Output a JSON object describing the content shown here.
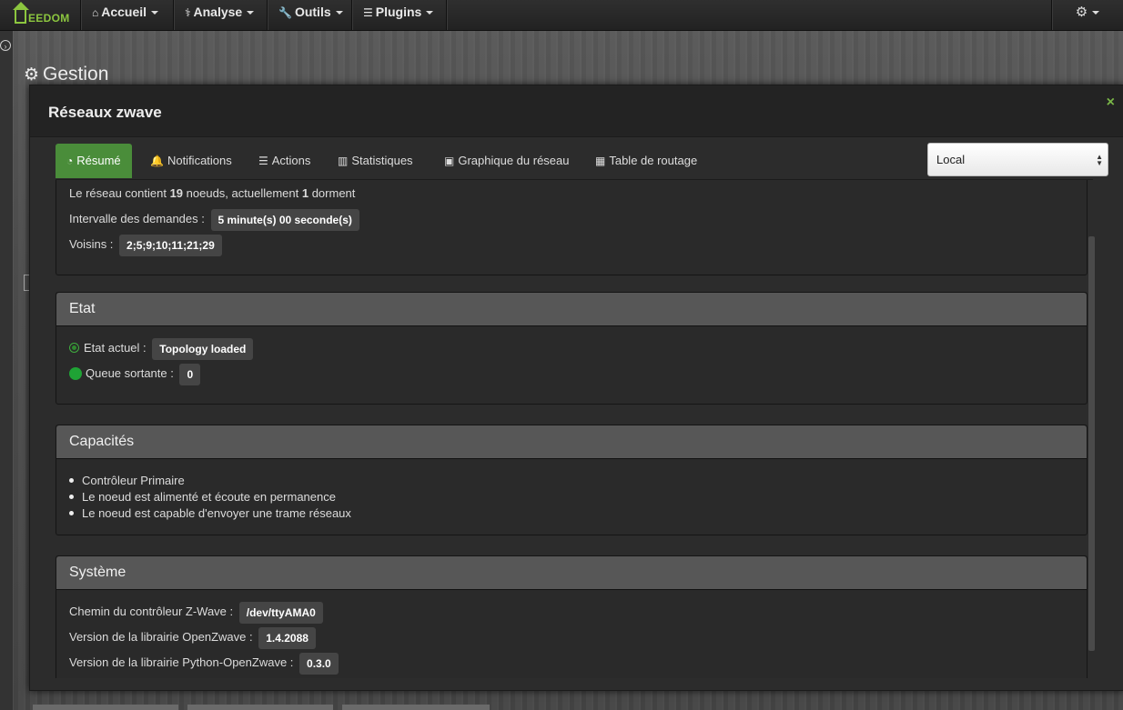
{
  "navbar": {
    "brand": "EEDOM",
    "items": [
      {
        "icon": "home-icon",
        "glyph": "⌂",
        "label": "Accueil"
      },
      {
        "icon": "stethoscope-icon",
        "glyph": "⚕",
        "label": "Analyse"
      },
      {
        "icon": "wrench-icon",
        "glyph": "🔧",
        "label": "Outils"
      },
      {
        "icon": "list-icon",
        "glyph": "☰",
        "label": "Plugins"
      }
    ],
    "settings_glyph": "⚙"
  },
  "page": {
    "title": "Gestion"
  },
  "modal": {
    "title": "Réseaux zwave",
    "close_glyph": "×",
    "tabs": [
      {
        "icon": "dashboard-icon",
        "glyph": "◔",
        "label": "Résumé",
        "active": true
      },
      {
        "icon": "bell-icon",
        "glyph": "🔔",
        "label": "Notifications"
      },
      {
        "icon": "sliders-icon",
        "glyph": "☰",
        "label": "Actions"
      },
      {
        "icon": "bar-chart-icon",
        "glyph": "▥",
        "label": "Statistiques"
      },
      {
        "icon": "image-icon",
        "glyph": "▣",
        "label": "Graphique du réseau"
      },
      {
        "icon": "table-icon",
        "glyph": "▦",
        "label": "Table de routage"
      }
    ],
    "controller_select": {
      "selected": "Local"
    }
  },
  "summary_panel": {
    "network_text_prefix": "Le réseau contient ",
    "nodes_count": "19",
    "network_text_mid": " noeuds, actuellement ",
    "sleeping_count": "1",
    "network_text_suffix": " dorment",
    "interval_label": "Intervalle des demandes :",
    "interval_value": "5 minute(s) 00 seconde(s)",
    "neighbors_label": "Voisins :",
    "neighbors_value": "2;5;9;10;11;21;29"
  },
  "etat_panel": {
    "title": "Etat",
    "current_label": "Etat actuel :",
    "current_value": "Topology loaded",
    "queue_label": "Queue sortante :",
    "queue_value": "0",
    "status_color": "#1fa335"
  },
  "capacites_panel": {
    "title": "Capacités",
    "items": [
      "Contrôleur Primaire",
      "Le noeud est alimenté et écoute en permanence",
      "Le noeud est capable d'envoyer une trame réseaux"
    ]
  },
  "systeme_panel": {
    "title": "Système",
    "controller_path_label": "Chemin du contrôleur Z-Wave :",
    "controller_path_value": "/dev/ttyAMA0",
    "openzwave_label": "Version de la librairie OpenZwave :",
    "openzwave_value": "1.4.2088",
    "python_openzwave_label": "Version de la librairie Python-OpenZwave :",
    "python_openzwave_value": "0.3.0"
  },
  "colors": {
    "accent_green": "#4a8d3a",
    "brand_green": "#8cc63f",
    "panel_heading": "#575757"
  }
}
